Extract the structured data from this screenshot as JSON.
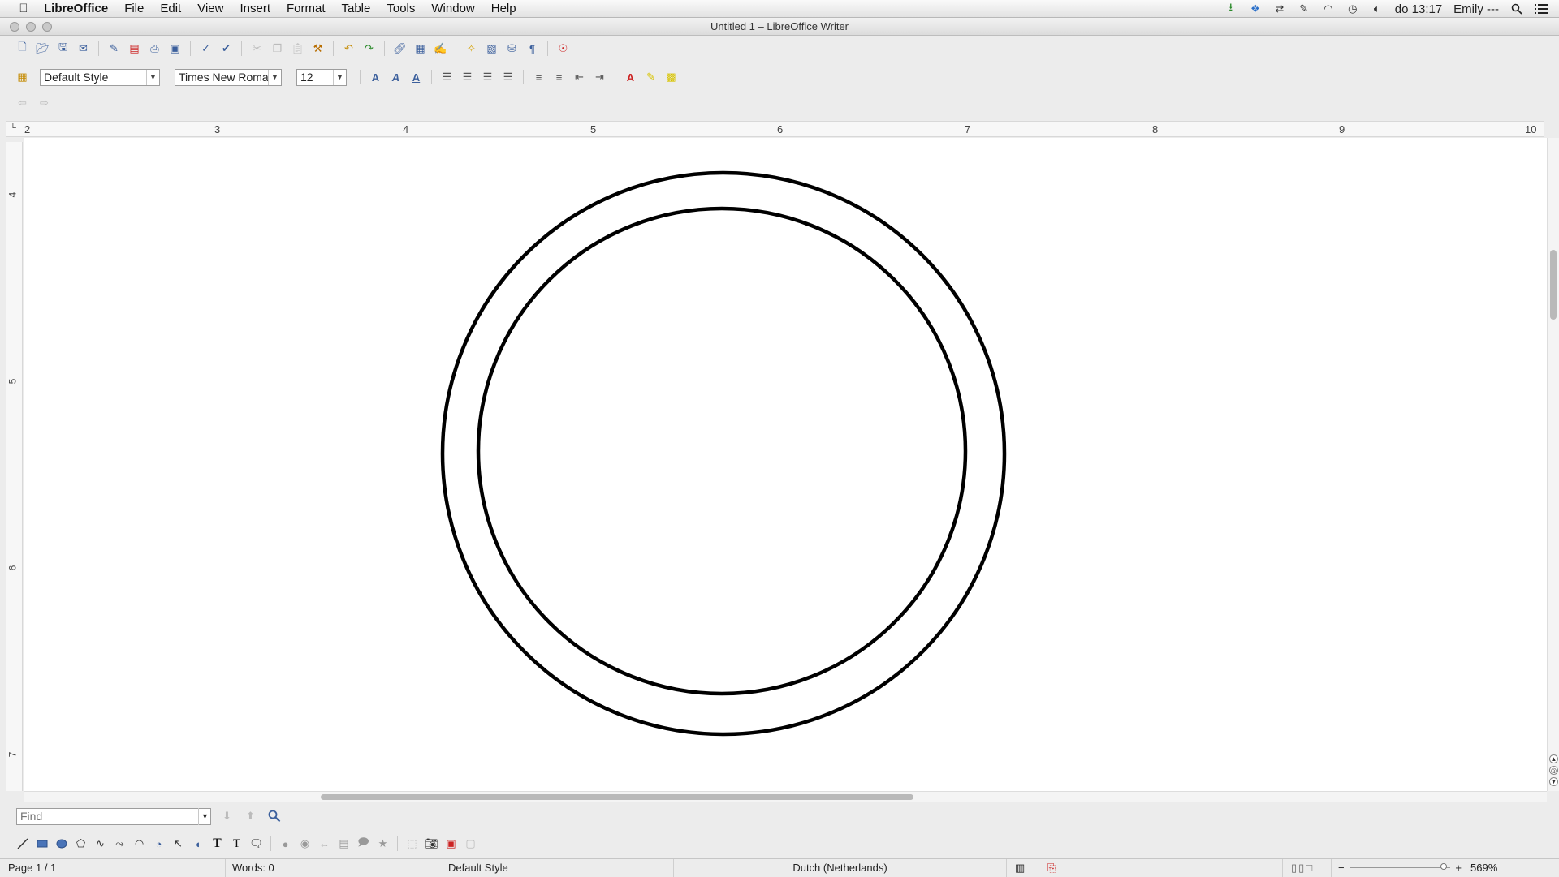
{
  "menubar": {
    "app_name": "LibreOffice",
    "items": [
      "File",
      "Edit",
      "View",
      "Insert",
      "Format",
      "Table",
      "Tools",
      "Window",
      "Help"
    ],
    "clock": "do 13:17",
    "user": "Emily ---"
  },
  "window": {
    "title": "Untitled 1 – LibreOffice Writer"
  },
  "formatting": {
    "paragraph_style": "Default Style",
    "font_name": "Times New Roma",
    "font_size": "12"
  },
  "ruler": {
    "horizontal": [
      "2",
      "3",
      "4",
      "5",
      "6",
      "7",
      "8",
      "9",
      "10"
    ],
    "vertical": [
      "4",
      "5",
      "6",
      "7"
    ]
  },
  "findbar": {
    "placeholder": "Find"
  },
  "status": {
    "page": "Page 1 / 1",
    "words": "Words: 0",
    "style": "Default Style",
    "language": "Dutch (Netherlands)",
    "zoom": "569%"
  },
  "icons": {
    "apple": "apple-logo-icon",
    "search": "spotlight-search-icon",
    "list": "notification-list-icon"
  }
}
